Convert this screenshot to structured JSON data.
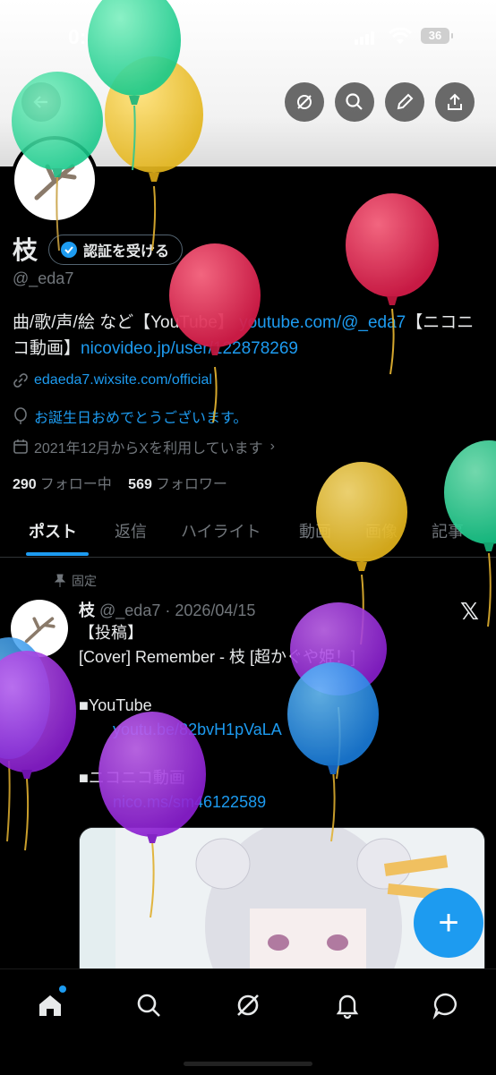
{
  "status_bar": {
    "time": "0:04",
    "battery": "36"
  },
  "header_actions": [
    "grok-icon",
    "search-icon",
    "edit-icon",
    "share-icon"
  ],
  "profile": {
    "name": "枝",
    "verify_label": "認証を受ける",
    "handle": "@_eda7",
    "bio_text": "曲/歌/声/絵 など【YouTube】",
    "bio_link1": "youtube.com/@_eda7",
    "bio_mid": "【ニコニコ動画】",
    "bio_link2": "nicovideo.jp/user/122878269",
    "website": "edaeda7.wixsite.com/official",
    "birthday": "お誕生日おめでとうございます。",
    "joined": "2021年12月からXを利用しています",
    "following_count": "290",
    "following_label": "フォロー中",
    "followers_count": "569",
    "followers_label": "フォロワー"
  },
  "tabs": [
    "ポスト",
    "返信",
    "ハイライト",
    "動画",
    "画像",
    "記事"
  ],
  "post": {
    "pinned_label": "固定",
    "author": "枝",
    "handle_date": "@_eda7 · 2026/04/15",
    "line1": "【投稿】",
    "line2": "[Cover] Remember - 枝 [超かぐや姫！]",
    "youtube_label": "■YouTube",
    "youtube_link": "youtu.be/82bvH1pVaLA",
    "nico_label": "■ニコニコ動画",
    "nico_link": "nico.ms/sm46122589"
  },
  "colors": {
    "accent": "#1d9bf0",
    "background": "#000000",
    "muted": "#71767b"
  },
  "nav": [
    "home-icon",
    "search-icon",
    "grok-icon",
    "notifications-icon",
    "messages-icon"
  ]
}
